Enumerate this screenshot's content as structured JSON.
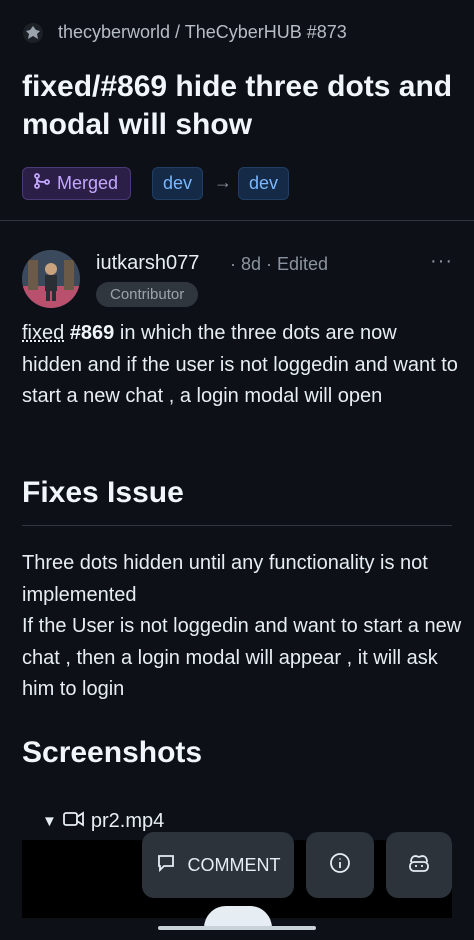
{
  "header": {
    "repo_path": "thecyberworld / TheCyberHUB #873",
    "title": "fixed/#869 hide three dots and modal will show"
  },
  "status": {
    "label": "Merged",
    "base_branch": "dev",
    "head_branch": "dev",
    "arrow": "→"
  },
  "comment": {
    "author": "iutkarsh077",
    "meta": "· 8d · Edited",
    "more": "···",
    "role": "Contributor",
    "intro_word": "fixed",
    "issue_ref": "#869",
    "intro_rest": "in which the three dots are now hidden and if the user is not loggedin and want to start a new chat , a login modal will open"
  },
  "sections": {
    "fixes_heading": "Fixes Issue",
    "fixes_line1": "Three dots hidden until any functionality is not implemented",
    "fixes_line2": "If the User is not loggedin and want to start a new chat , then a login modal will appear , it will ask him to login",
    "screenshots_heading": "Screenshots",
    "video_caret": "▼",
    "video_name": "pr2.mp4"
  },
  "actions": {
    "comment_label": "COMMENT"
  },
  "colors": {
    "background": "#0d1117",
    "merged": "#c4a8ff",
    "branch": "#79b8ff"
  }
}
